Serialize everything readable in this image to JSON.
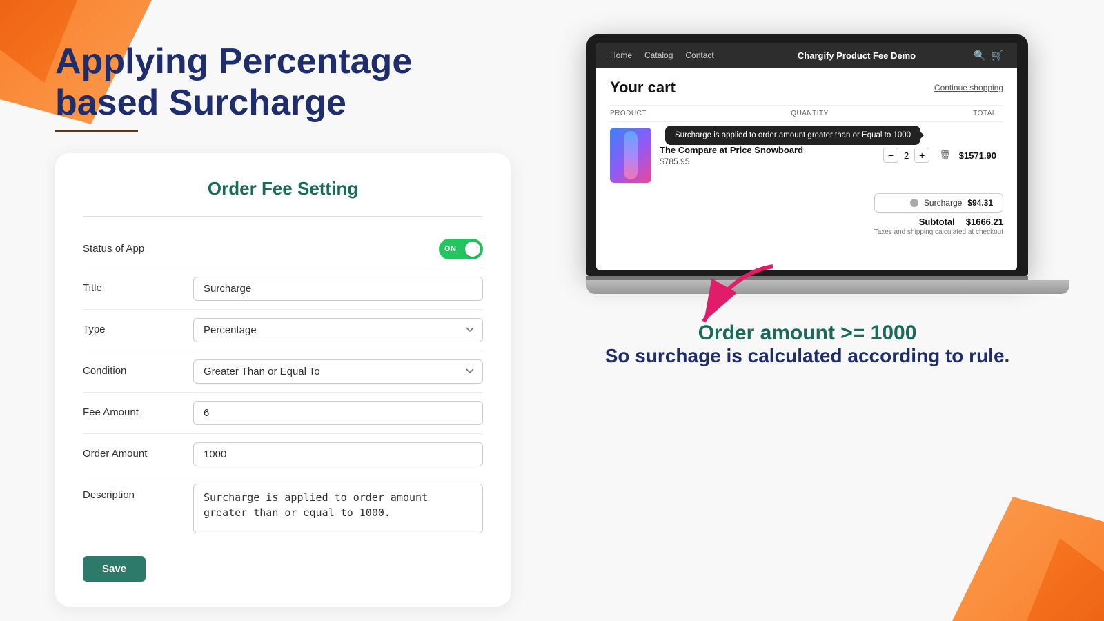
{
  "page": {
    "title_line1": "Applying Percentage",
    "title_line2": "based Surcharge"
  },
  "form": {
    "card_title": "Order Fee Setting",
    "fields": {
      "status_label": "Status of App",
      "status_value": "ON",
      "title_label": "Title",
      "title_value": "Surcharge",
      "type_label": "Type",
      "type_value": "Percentage",
      "condition_label": "Condition",
      "condition_value": "Greater Than or Equal To",
      "fee_amount_label": "Fee Amount",
      "fee_amount_value": "6",
      "order_amount_label": "Order Amount",
      "order_amount_value": "1000",
      "description_label": "Description",
      "description_value": "Surcharge is applied to order amount greater than or equal to 1000."
    },
    "save_button": "Save"
  },
  "laptop": {
    "nav": {
      "links": [
        "Home",
        "Catalog",
        "Contact"
      ],
      "brand": "Chargify Product Fee Demo"
    },
    "cart": {
      "title": "Your cart",
      "continue_shopping": "Continue shopping",
      "headers": {
        "product": "PRODUCT",
        "quantity": "QUANTITY",
        "total": "TOTAL"
      },
      "product": {
        "name": "The Compare at Price Snowboard",
        "price": "$785.95",
        "quantity": "2",
        "total": "$1571.90"
      },
      "tooltip": "Surcharge is applied to order amount greater than or Equal to 1000",
      "surcharge": {
        "label": "Surcharge",
        "amount": "$94.31"
      },
      "subtotal_label": "Subtotal",
      "subtotal_amount": "$1666.21",
      "taxes_note": "Taxes and shipping calculated at checkout"
    }
  },
  "bottom_text": {
    "line1": "Order amount >= 1000",
    "line2": "So surchage is calculated according to rule."
  }
}
